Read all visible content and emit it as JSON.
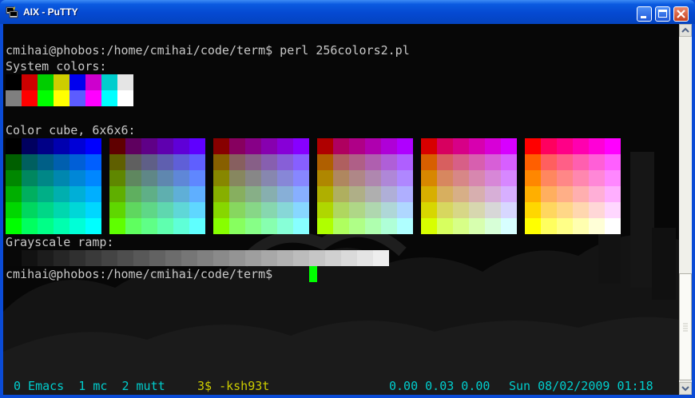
{
  "window": {
    "title": "AIX - PuTTY"
  },
  "terminal": {
    "line1": "cmihai@phobos:/home/cmihai/code/term$ perl 256colors2.pl",
    "line2": "System colors:",
    "line3": "Color cube, 6x6x6:",
    "line4": "Grayscale ramp:",
    "prompt": "cmihai@phobos:/home/cmihai/code/term$ "
  },
  "system_colors": {
    "row1": [
      "#000000",
      "#cd0000",
      "#00cd00",
      "#cdcd00",
      "#0000ee",
      "#cd00cd",
      "#00cdcd",
      "#e5e5e5"
    ],
    "row2": [
      "#7f7f7f",
      "#ff0000",
      "#00ff00",
      "#ffff00",
      "#5c5cff",
      "#ff00ff",
      "#00ffff",
      "#ffffff"
    ]
  },
  "cube_levels": [
    0,
    95,
    135,
    175,
    215,
    255
  ],
  "grayscale_levels": [
    8,
    18,
    28,
    38,
    48,
    58,
    68,
    78,
    88,
    98,
    108,
    118,
    128,
    138,
    148,
    158,
    168,
    178,
    188,
    198,
    208,
    218,
    228,
    238
  ],
  "status": {
    "tabs": "0 Emacs  1 mc  2 mutt  ",
    "active_tab": "3$ -ksh93t",
    "load": "0.00 0.03 0.00",
    "datetime": "Sun 08/02/2009 01:18"
  },
  "colors": {
    "status_cyan": "#00cdcd",
    "status_active": "#cdcd00",
    "terminal_text": "#c8c8c8",
    "cursor": "#00ff00"
  }
}
